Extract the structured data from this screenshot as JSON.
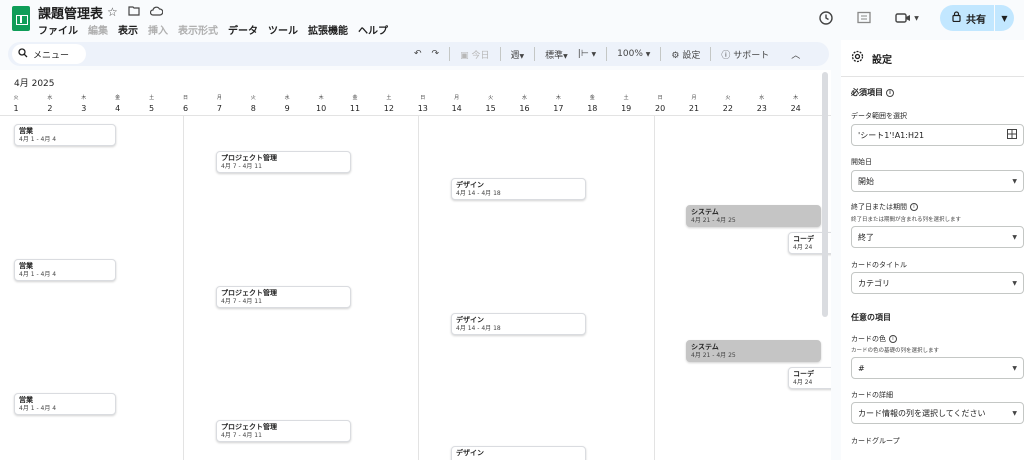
{
  "app": {
    "doc_title": "課題管理表",
    "menu": [
      {
        "label": "ファイル",
        "enabled": true
      },
      {
        "label": "編集",
        "enabled": false
      },
      {
        "label": "表示",
        "enabled": true
      },
      {
        "label": "挿入",
        "enabled": false
      },
      {
        "label": "表示形式",
        "enabled": false
      },
      {
        "label": "データ",
        "enabled": true
      },
      {
        "label": "ツール",
        "enabled": true
      },
      {
        "label": "拡張機能",
        "enabled": true
      },
      {
        "label": "ヘルプ",
        "enabled": true
      }
    ],
    "share_label": "共有"
  },
  "toolbar": {
    "menu_search": "メニュー",
    "today": "今日",
    "period": "週",
    "standard": "標準",
    "zoom": "100%",
    "settings": "設定",
    "support": "サポート"
  },
  "timeline": {
    "month": "4月 2025",
    "days": [
      {
        "dow": "火",
        "num": "1"
      },
      {
        "dow": "水",
        "num": "2"
      },
      {
        "dow": "木",
        "num": "3"
      },
      {
        "dow": "金",
        "num": "4"
      },
      {
        "dow": "土",
        "num": "5"
      },
      {
        "dow": "日",
        "num": "6"
      },
      {
        "dow": "月",
        "num": "7"
      },
      {
        "dow": "火",
        "num": "8"
      },
      {
        "dow": "水",
        "num": "9"
      },
      {
        "dow": "木",
        "num": "10"
      },
      {
        "dow": "金",
        "num": "11"
      },
      {
        "dow": "土",
        "num": "12"
      },
      {
        "dow": "日",
        "num": "13"
      },
      {
        "dow": "月",
        "num": "14"
      },
      {
        "dow": "火",
        "num": "15"
      },
      {
        "dow": "水",
        "num": "16"
      },
      {
        "dow": "木",
        "num": "17"
      },
      {
        "dow": "金",
        "num": "18"
      },
      {
        "dow": "土",
        "num": "19"
      },
      {
        "dow": "日",
        "num": "20"
      },
      {
        "dow": "月",
        "num": "21"
      },
      {
        "dow": "火",
        "num": "22"
      },
      {
        "dow": "水",
        "num": "23"
      },
      {
        "dow": "木",
        "num": "24"
      }
    ],
    "cards": [
      {
        "title": "営業",
        "dates": "4月 1 - 4月 4",
        "style": "white"
      },
      {
        "title": "プロジェクト管理",
        "dates": "4月 7 - 4月 11",
        "style": "white"
      },
      {
        "title": "デザイン",
        "dates": "4月 14 - 4月 18",
        "style": "white"
      },
      {
        "title": "システム",
        "dates": "4月 21 - 4月 25",
        "style": "gray"
      },
      {
        "title": "コーデ",
        "dates": "4月 24",
        "style": "white"
      },
      {
        "title": "営業",
        "dates": "4月 1 - 4月 4",
        "style": "white"
      },
      {
        "title": "プロジェクト管理",
        "dates": "4月 7 - 4月 11",
        "style": "white"
      },
      {
        "title": "デザイン",
        "dates": "4月 14 - 4月 18",
        "style": "white"
      },
      {
        "title": "システム",
        "dates": "4月 21 - 4月 25",
        "style": "gray"
      },
      {
        "title": "コーデ",
        "dates": "4月 24",
        "style": "white"
      },
      {
        "title": "営業",
        "dates": "4月 1 - 4月 4",
        "style": "white"
      },
      {
        "title": "プロジェクト管理",
        "dates": "4月 7 - 4月 11",
        "style": "white"
      },
      {
        "title": "デザイン",
        "dates": "",
        "style": "white"
      }
    ]
  },
  "panel": {
    "title": "設定",
    "required_section": "必須項目",
    "data_range_label": "データ範囲を選択",
    "data_range_value": "'シート1'!A1:H21",
    "start_label": "開始日",
    "start_value": "開始",
    "end_label": "終了日または期間",
    "end_sub": "終了日または期間が含まれる列を選択します",
    "end_value": "終了",
    "card_title_label": "カードのタイトル",
    "card_title_value": "カテゴリ",
    "optional_section": "任意の項目",
    "card_color_label": "カードの色",
    "card_color_sub": "カードの色の基礎の列を選択します",
    "card_color_value": "#",
    "card_detail_label": "カードの詳細",
    "card_detail_value": "カード情報の列を選択してください",
    "card_group_label": "カードグループ"
  }
}
